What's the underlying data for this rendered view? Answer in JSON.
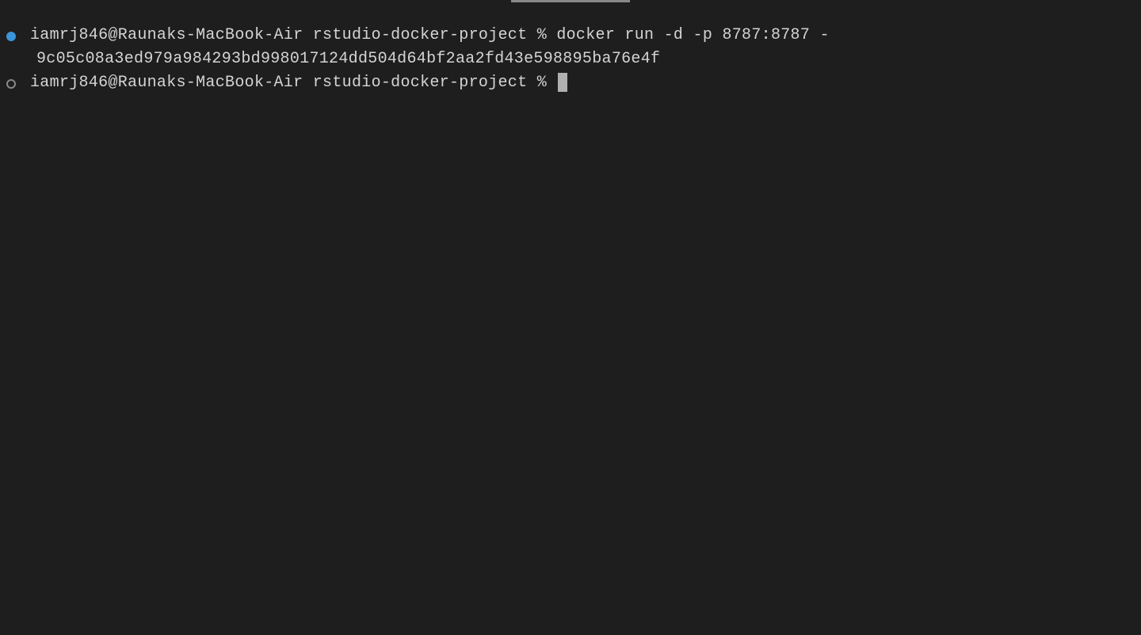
{
  "terminal": {
    "lines": [
      {
        "type": "prompt-with-command",
        "dot": "filled",
        "prompt": "iamrj846@Raunaks-MacBook-Air rstudio-docker-project % ",
        "command": "docker run -d -p 8787:8787 -"
      },
      {
        "type": "output",
        "text": "9c05c08a3ed979a984293bd998017124dd504d64bf2aa2fd43e598895ba76e4f"
      },
      {
        "type": "prompt-empty",
        "dot": "hollow",
        "prompt": "iamrj846@Raunaks-MacBook-Air rstudio-docker-project % "
      }
    ]
  },
  "colors": {
    "background": "#1e1e1e",
    "text": "#d4d4d4",
    "active_dot": "#3b94d9",
    "inactive_dot_border": "#888",
    "cursor": "#b0b0b0"
  }
}
